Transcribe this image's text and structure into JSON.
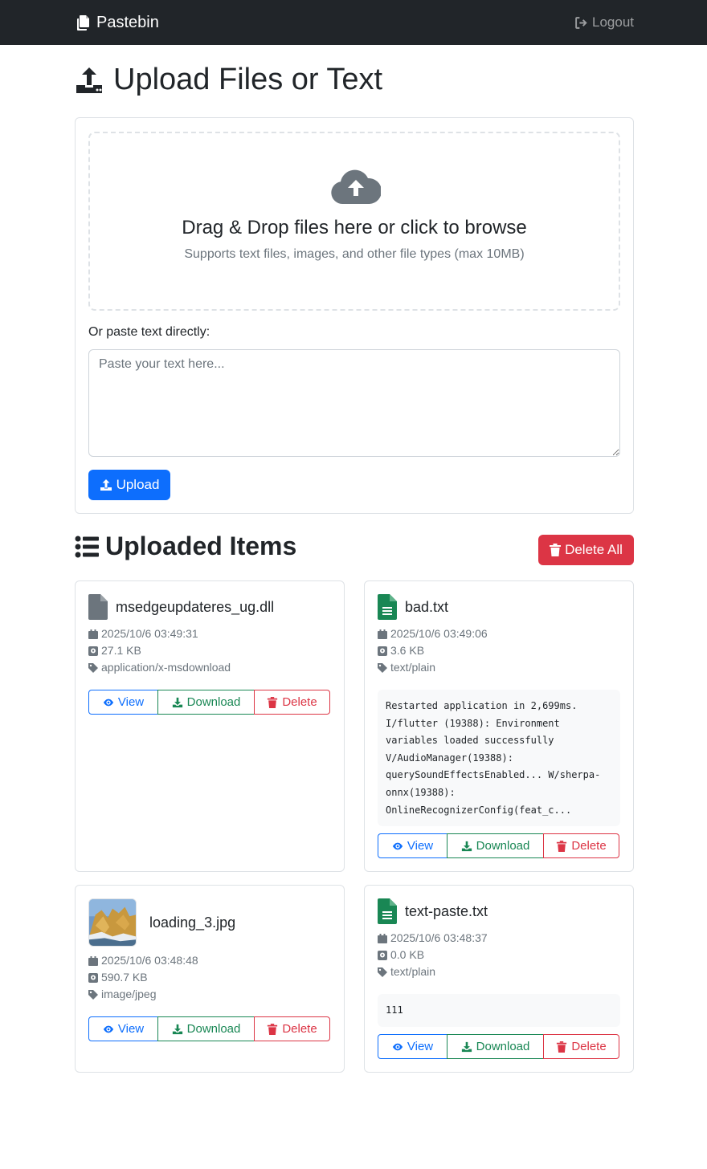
{
  "nav": {
    "brand": "Pastebin",
    "logout": "Logout"
  },
  "page_title": "Upload Files or Text",
  "dropzone": {
    "title": "Drag & Drop files here or click to browse",
    "subtitle": "Supports text files, images, and other file types (max 10MB)"
  },
  "paste": {
    "label": "Or paste text directly:",
    "placeholder": "Paste your text here...",
    "value": ""
  },
  "upload_button": "Upload",
  "items_heading": "Uploaded Items",
  "delete_all": "Delete All",
  "buttons": {
    "view": "View",
    "download": "Download",
    "delete": "Delete"
  },
  "colors": {
    "navbar": "#212529",
    "primary": "#0d6efd",
    "success": "#198754",
    "danger": "#dc3545",
    "muted": "#6c757d"
  },
  "items": [
    {
      "name": "msedgeupdateres_ug.dll",
      "date": "2025/10/6 03:49:31",
      "size": "27.1 KB",
      "type": "application/x-msdownload",
      "icon": "file-icon",
      "preview": ""
    },
    {
      "name": "bad.txt",
      "date": "2025/10/6 03:49:06",
      "size": "3.6 KB",
      "type": "text/plain",
      "icon": "file-text-icon",
      "preview": "Restarted application in 2,699ms. I/flutter (19388): Environment variables loaded successfully V/AudioManager(19388): querySoundEffectsEnabled... W/sherpa-onnx(19388): OnlineRecognizerConfig(feat_c..."
    },
    {
      "name": "loading_3.jpg",
      "date": "2025/10/6 03:48:48",
      "size": "590.7 KB",
      "type": "image/jpeg",
      "icon": "image-thumbnail",
      "preview": ""
    },
    {
      "name": "text-paste.txt",
      "date": "2025/10/6 03:48:37",
      "size": "0.0 KB",
      "type": "text/plain",
      "icon": "file-text-icon",
      "preview": "111"
    }
  ]
}
